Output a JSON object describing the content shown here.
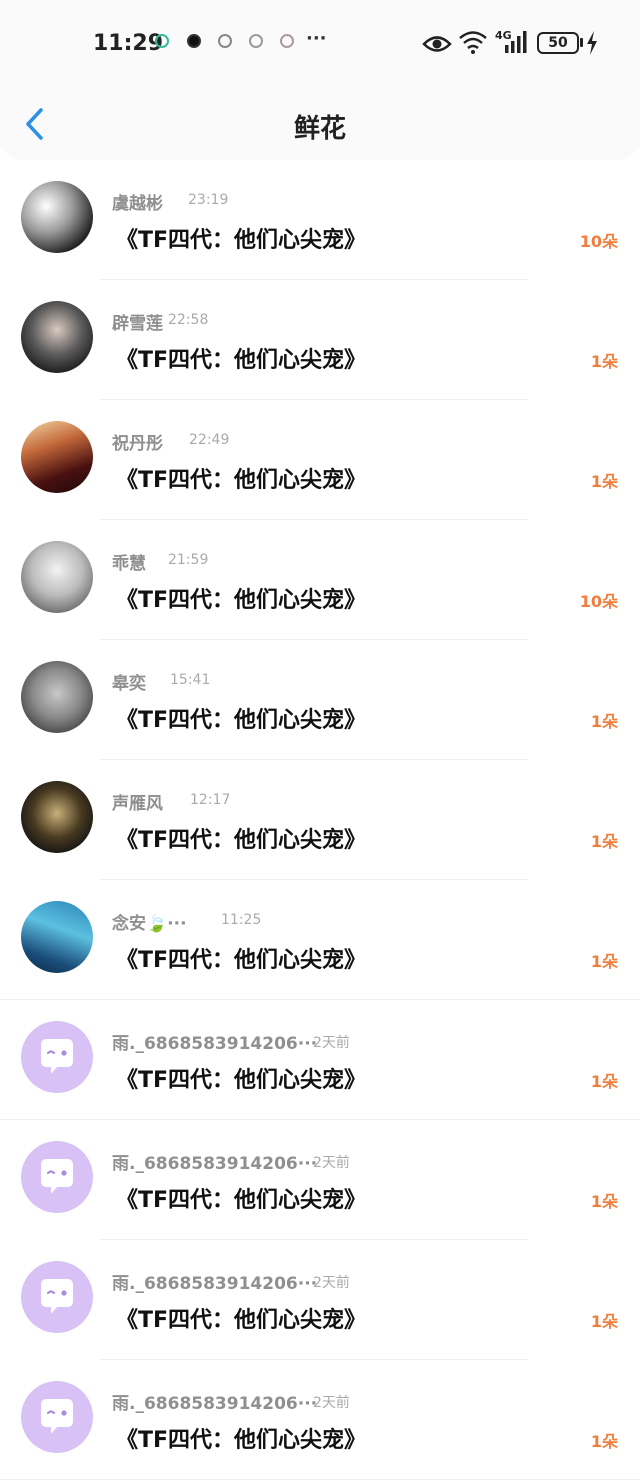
{
  "status_bar": {
    "time": "11:29",
    "signal_label": "4G",
    "battery": "50",
    "more": "···"
  },
  "header": {
    "title": "鲜花"
  },
  "colors": {
    "accent": "#2f8fe0",
    "flower_count": "#f07d3c",
    "placeholder_avatar": "#d7c1f5"
  },
  "list": [
    {
      "name": "虞越彬",
      "time": "23:19",
      "title": "《TF四代：他们心尖宠》",
      "flowers": "10朵",
      "avatar": "photo"
    },
    {
      "name": "辟雪莲",
      "time": "22:58",
      "title": "《TF四代：他们心尖宠》",
      "flowers": "1朵",
      "avatar": "photo"
    },
    {
      "name": "祝丹彤",
      "time": "22:49",
      "title": "《TF四代：他们心尖宠》",
      "flowers": "1朵",
      "avatar": "photo"
    },
    {
      "name": "乖慧",
      "time": "21:59",
      "title": "《TF四代：他们心尖宠》",
      "flowers": "10朵",
      "avatar": "photo"
    },
    {
      "name": "皋奕",
      "time": "15:41",
      "title": "《TF四代：他们心尖宠》",
      "flowers": "1朵",
      "avatar": "photo"
    },
    {
      "name": "声雁风",
      "time": "12:17",
      "title": "《TF四代：他们心尖宠》",
      "flowers": "1朵",
      "avatar": "photo"
    },
    {
      "name": "念安🍃···",
      "time": "11:25",
      "title": "《TF四代：他们心尖宠》",
      "flowers": "1朵",
      "avatar": "photo"
    },
    {
      "name": "雨._6868583914206···",
      "time": "2天前",
      "title": "《TF四代：他们心尖宠》",
      "flowers": "1朵",
      "avatar": "default"
    },
    {
      "name": "雨._6868583914206···",
      "time": "2天前",
      "title": "《TF四代：他们心尖宠》",
      "flowers": "1朵",
      "avatar": "default"
    },
    {
      "name": "雨._6868583914206···",
      "time": "2天前",
      "title": "《TF四代：他们心尖宠》",
      "flowers": "1朵",
      "avatar": "default"
    },
    {
      "name": "雨._6868583914206···",
      "time": "2天前",
      "title": "《TF四代：他们心尖宠》",
      "flowers": "1朵",
      "avatar": "default"
    }
  ]
}
